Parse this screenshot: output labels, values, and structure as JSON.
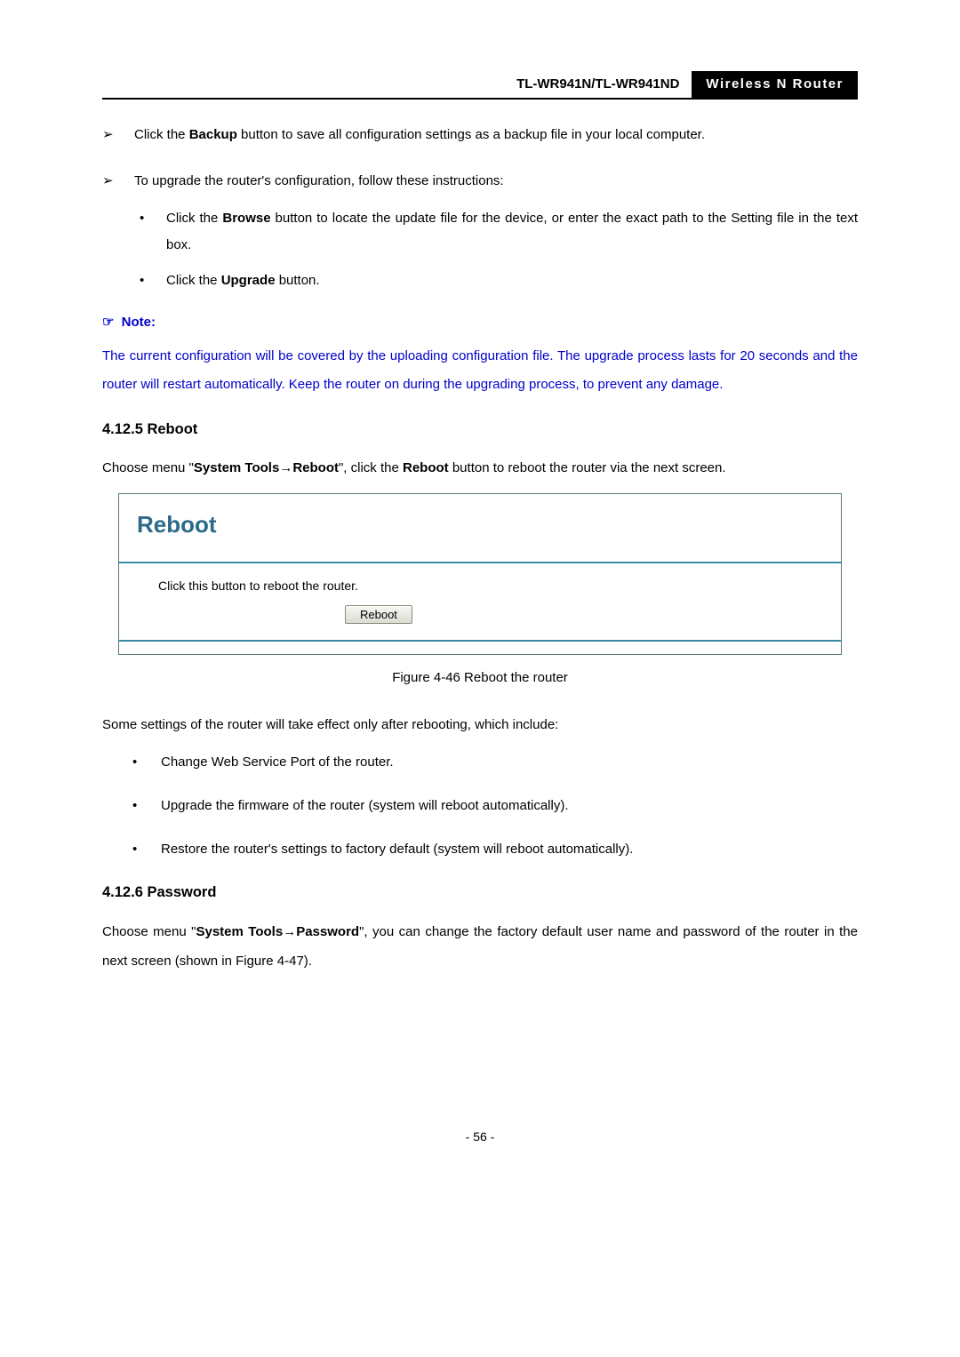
{
  "header": {
    "model": "TL-WR941N/TL-WR941ND",
    "product": "Wireless  N  Router"
  },
  "backup_restore": {
    "item1_pre": "Click the ",
    "item1_bold": "Backup",
    "item1_post": " button to save all configuration settings as a backup file in your local computer.",
    "item2": "To upgrade the router's configuration, follow these instructions:",
    "sub1_pre": "Click the ",
    "sub1_bold": "Browse",
    "sub1_post": " button to locate the update file for the device, or enter the exact path to the Setting file in the text box.",
    "sub2_pre": "Click the ",
    "sub2_bold": "Upgrade",
    "sub2_post": " button."
  },
  "note": {
    "icon": "☞",
    "label": "Note:",
    "body": "The current configuration will be covered by the uploading configuration file. The upgrade process lasts for 20 seconds and the router will restart automatically. Keep the router on during the upgrading process, to prevent any damage."
  },
  "s1": {
    "heading": "4.12.5 Reboot",
    "pre": "Choose menu \"",
    "bold1": "System Tools",
    "arrow": "→",
    "bold2": "Reboot",
    "mid": "\", click the ",
    "bold3": "Reboot",
    "post": " button to reboot the router via the next screen."
  },
  "figure": {
    "title": "Reboot",
    "body_text": "Click this button to reboot the router.",
    "button": "Reboot",
    "caption": "Figure 4-46 Reboot the router"
  },
  "after_fig": "Some settings of the router will take effect only after rebooting, which include:",
  "bullets": {
    "b1": "Change Web Service Port of the router.",
    "b2": "Upgrade the firmware of the router (system will reboot automatically).",
    "b3": "Restore the router's settings to factory default (system will reboot automatically)."
  },
  "s2": {
    "heading": "4.12.6 Password",
    "pre": "Choose menu \"",
    "bold1": "System Tools",
    "arrow": "→",
    "bold2": "Password",
    "post": "\", you can change the factory default user name and password of the router in the next screen (shown in Figure 4-47)."
  },
  "page": "- 56 -"
}
